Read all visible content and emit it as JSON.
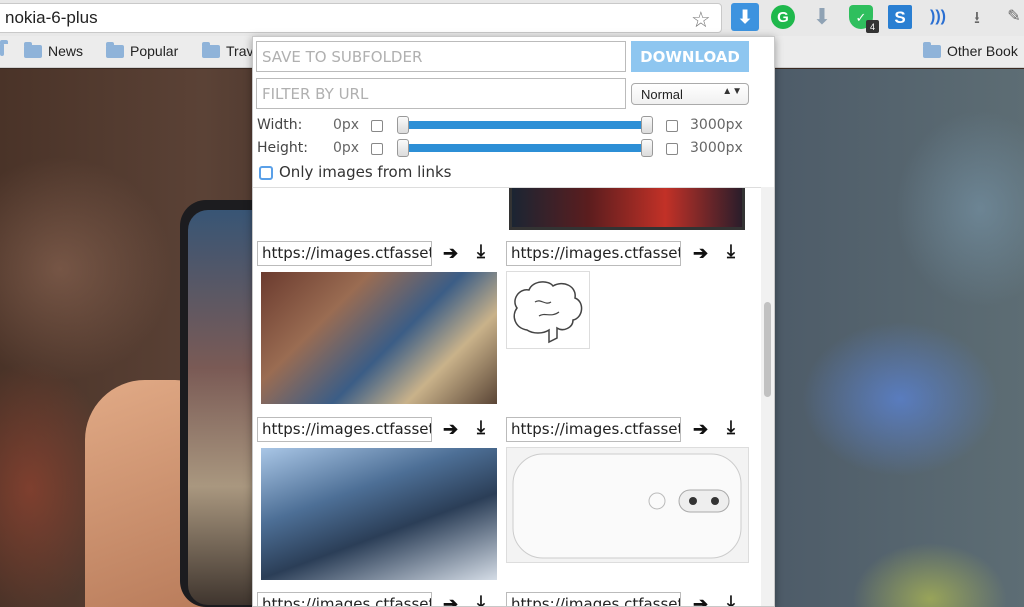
{
  "browser": {
    "address": "nokia-6-plus",
    "extensions": {
      "active_download": "⬇",
      "grammarly": "G",
      "arrow": "⬇",
      "shield": "✓",
      "shield_badge": "4",
      "s_ext": "S",
      "wave": ")))",
      "dl": "⭳",
      "pen": "✎"
    }
  },
  "bookmarks": {
    "items": [
      "News",
      "Popular",
      "Trav"
    ],
    "other": "Other Book"
  },
  "popup": {
    "subfolder_placeholder": "SAVE TO SUBFOLDER",
    "download_label": "DOWNLOAD",
    "filter_placeholder": "FILTER BY URL",
    "filter_mode": "Normal",
    "width": {
      "label": "Width:",
      "min": "0px",
      "max": "3000px"
    },
    "height": {
      "label": "Height:",
      "min": "0px",
      "max": "3000px"
    },
    "only_links_label": "Only images from links",
    "images": [
      {
        "url": "https://images.ctfassets"
      },
      {
        "url": "https://images.ctfassets"
      },
      {
        "url": "https://images.ctfassets"
      },
      {
        "url": "https://images.ctfassets"
      },
      {
        "url": "https://images.ctfassets"
      },
      {
        "url": "https://images.ctfassets"
      }
    ],
    "open_icon": "➔",
    "download_icon": "⤓"
  }
}
